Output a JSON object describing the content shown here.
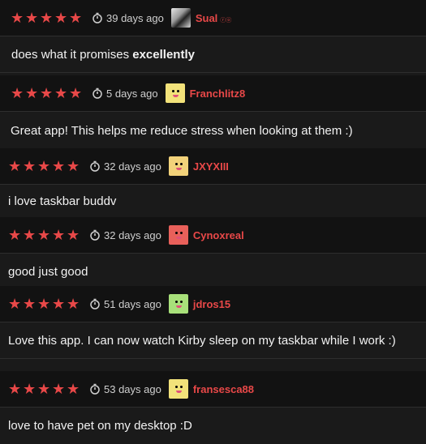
{
  "accent": "#e84848",
  "reviews": [
    {
      "stars": 5,
      "time": "39 days ago",
      "user": "Sual",
      "user_suffix": "ⓡⓞ",
      "text": "does what it promises ",
      "text_bold": "excellently"
    },
    {
      "stars": 5,
      "time": "5 days ago",
      "user": "Franchlitz8",
      "text": "Great app! This helps me reduce stress when looking at them :)"
    },
    {
      "stars": 5,
      "time": "32 days ago",
      "user": "JXYXIII",
      "text": "i love taskbar buddv"
    },
    {
      "stars": 5,
      "time": "32 days ago",
      "user": "Cynoxreal",
      "text": "good just good"
    },
    {
      "stars": 5,
      "time": "51 days ago",
      "user": "jdros15",
      "text": "Love this app. I can now watch Kirby sleep on my taskbar while I work :)"
    },
    {
      "stars": 5,
      "time": "53 days ago",
      "user": "fransesca88",
      "text": "love to have pet on my desktop :D"
    }
  ]
}
